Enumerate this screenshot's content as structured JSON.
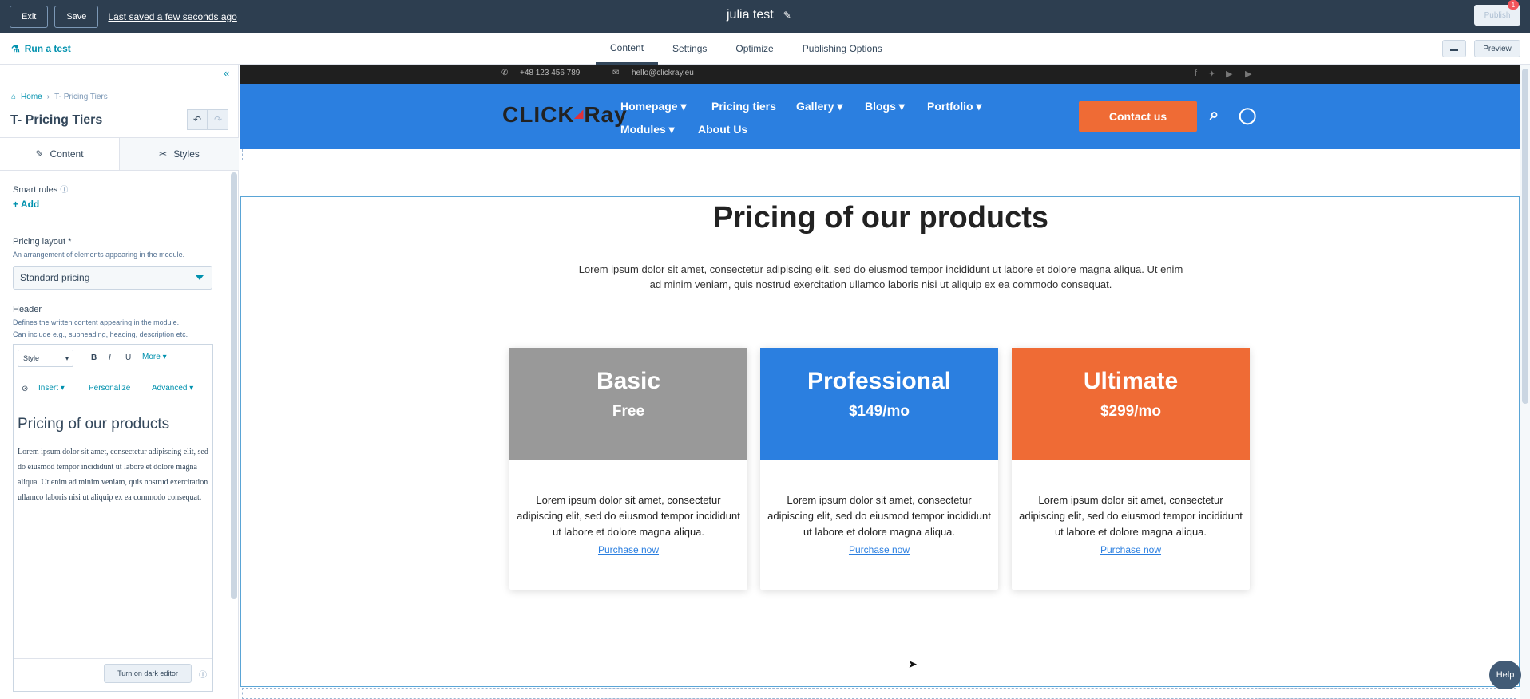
{
  "topbar": {
    "exit_label": "Exit",
    "save_label": "Save",
    "saved_status": "Last saved a few seconds ago",
    "page_title": "julia test",
    "publish_label": "Publish",
    "notification_count": "1"
  },
  "subbar": {
    "run_test_label": "Run a test",
    "tabs": [
      {
        "label": "Content",
        "active": true
      },
      {
        "label": "Settings",
        "active": false
      },
      {
        "label": "Optimize",
        "active": false
      },
      {
        "label": "Publishing Options",
        "active": false
      }
    ],
    "preview_label": "Preview"
  },
  "panel": {
    "breadcrumb": {
      "home": "Home",
      "current": "T- Pricing Tiers"
    },
    "module_title": "T- Pricing Tiers",
    "tabs": [
      {
        "label": "Content",
        "icon": "pencil-icon"
      },
      {
        "label": "Styles",
        "icon": "brush-icon"
      }
    ],
    "smart_rules_label": "Smart rules",
    "add_label": "Add",
    "pricing_layout_label": "Pricing layout *",
    "pricing_layout_hint": "An arrangement of elements appearing in the module.",
    "pricing_layout_value": "Standard pricing",
    "header_label": "Header",
    "header_hint_1": "Defines the written content appearing in the module.",
    "header_hint_2": "Can include e.g., subheading, heading, description etc.",
    "editor": {
      "style_label": "Style",
      "bold": "B",
      "italic": "I",
      "underline": "U",
      "more_label": "More",
      "insert_label": "Insert",
      "personalize_label": "Personalize",
      "advanced_label": "Advanced",
      "heading": "Pricing of our products",
      "body": "Lorem ipsum dolor sit amet, consectetur adipiscing elit, sed do eiusmod tempor incididunt ut labore et dolore magna aliqua. Ut enim ad minim veniam, quis nostrud exercitation ullamco laboris nisi ut aliquip ex ea commodo consequat.",
      "dark_editor_label": "Turn on dark editor"
    }
  },
  "site": {
    "phone": "+48 123 456 789",
    "email": "hello@clickray.eu",
    "logo_text_1": "CLICK",
    "logo_text_2": "Ray",
    "nav": [
      "Homepage",
      "Pricing tiers",
      "Gallery",
      "Blogs",
      "Portfolio",
      "Modules",
      "About Us"
    ],
    "contact_label": "Contact us",
    "section_title": "Pricing of our products",
    "section_desc": "Lorem ipsum dolor sit amet, consectetur adipiscing elit, sed do eiusmod tempor incididunt ut labore et dolore magna aliqua. Ut enim ad minim veniam, quis nostrud exercitation ullamco laboris nisi ut aliquip ex ea commodo consequat.",
    "cards": [
      {
        "name": "Basic",
        "price": "Free",
        "color": "#999999",
        "desc": "Lorem ipsum dolor sit amet, consectetur adipiscing elit, sed do eiusmod tempor incididunt ut labore et dolore magna aliqua.",
        "link": "Purchase now"
      },
      {
        "name": "Professional",
        "price": "$149/mo",
        "color": "#2b7fe0",
        "desc": "Lorem ipsum dolor sit amet, consectetur adipiscing elit, sed do eiusmod tempor incididunt ut labore et dolore magna aliqua.",
        "link": "Purchase now"
      },
      {
        "name": "Ultimate",
        "price": "$299/mo",
        "color": "#ef6b35",
        "desc": "Lorem ipsum dolor sit amet, consectetur adipiscing elit, sed do eiusmod tempor incididunt ut labore et dolore magna aliqua.",
        "link": "Purchase now"
      }
    ]
  },
  "help_label": "Help"
}
